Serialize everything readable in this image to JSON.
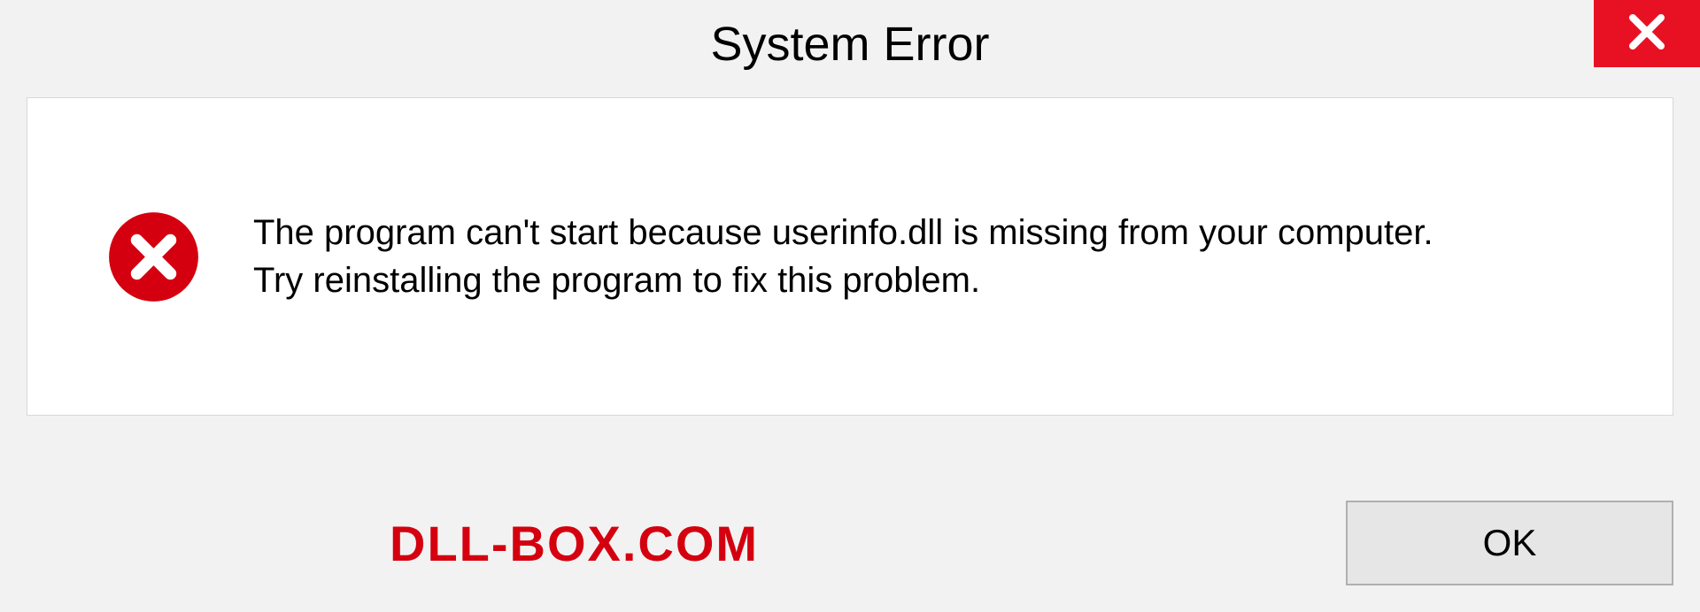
{
  "title": "System Error",
  "message": {
    "line1": "The program can't start because userinfo.dll is missing from your computer.",
    "line2": "Try reinstalling the program to fix this problem."
  },
  "watermark": "DLL-BOX.COM",
  "buttons": {
    "ok": "OK"
  },
  "colors": {
    "close_bg": "#e81123",
    "error_icon": "#d4000f",
    "watermark": "#d4000f"
  }
}
